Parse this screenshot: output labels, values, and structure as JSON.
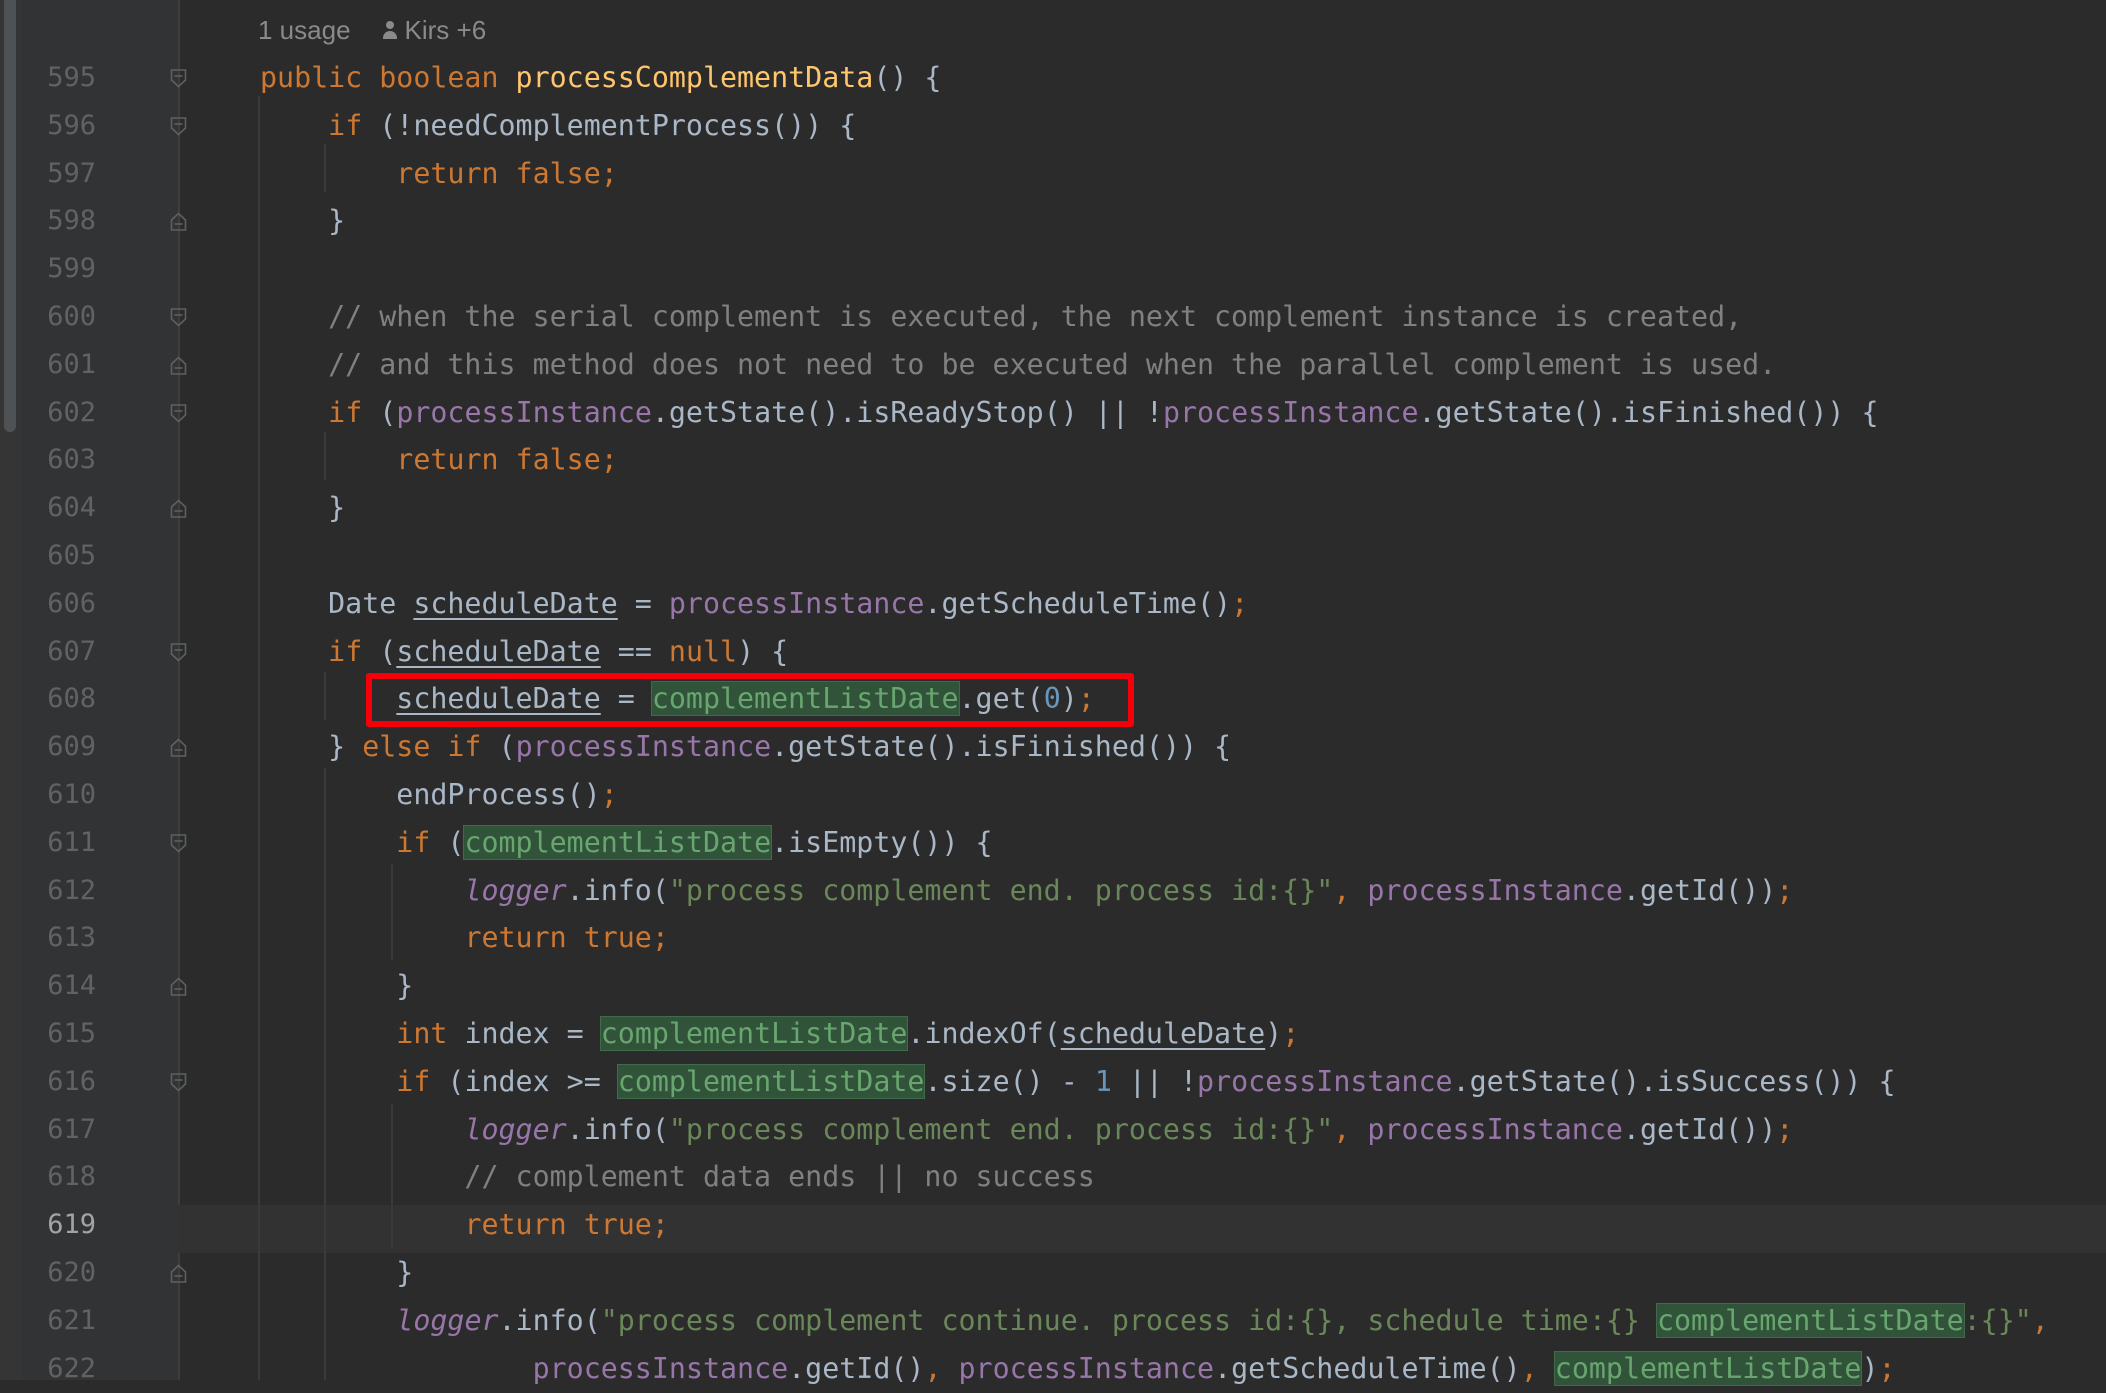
{
  "inlay": {
    "usages": "1 usage",
    "authors": "Kirs +6"
  },
  "colors": {
    "background": "#2b2b2b",
    "keyword": "#cc7832",
    "method": "#ffc66d",
    "field": "#9876aa",
    "comment": "#808080",
    "string": "#6a8759",
    "number": "#6897bb",
    "annotation_box": "#f5000a"
  },
  "lines": [
    {
      "n": "595",
      "tokens": [
        [
          "public boolean ",
          "kw"
        ],
        [
          "processComplementData",
          "fn"
        ],
        [
          "() {",
          ""
        ]
      ]
    },
    {
      "n": "596",
      "tokens": [
        [
          "    ",
          ""
        ],
        [
          "if ",
          "kw"
        ],
        [
          "(!needComplementProcess()) {",
          ""
        ]
      ]
    },
    {
      "n": "597",
      "tokens": [
        [
          "        ",
          ""
        ],
        [
          "return false;",
          "kw"
        ]
      ]
    },
    {
      "n": "598",
      "tokens": [
        [
          "    }",
          ""
        ]
      ]
    },
    {
      "n": "599",
      "tokens": []
    },
    {
      "n": "600",
      "tokens": [
        [
          "    // when the serial complement is executed, the next complement instance is created,",
          "cmt"
        ]
      ]
    },
    {
      "n": "601",
      "tokens": [
        [
          "    // and this method does not need to be executed when the parallel complement is used.",
          "cmt"
        ]
      ]
    },
    {
      "n": "602",
      "tokens": [
        [
          "    ",
          ""
        ],
        [
          "if ",
          "kw"
        ],
        [
          "(",
          ""
        ],
        [
          "processInstance",
          "fld"
        ],
        [
          ".getState().isReadyStop() || !",
          ""
        ],
        [
          "processInstance",
          "fld"
        ],
        [
          ".getState().isFinished()) {",
          ""
        ]
      ]
    },
    {
      "n": "603",
      "tokens": [
        [
          "        ",
          ""
        ],
        [
          "return false;",
          "kw"
        ]
      ]
    },
    {
      "n": "604",
      "tokens": [
        [
          "    }",
          ""
        ]
      ]
    },
    {
      "n": "605",
      "tokens": []
    },
    {
      "n": "606",
      "tokens": [
        [
          "    Date ",
          ""
        ],
        [
          "scheduleDate",
          "var"
        ],
        [
          " = ",
          ""
        ],
        [
          "processInstance",
          "fld"
        ],
        [
          ".getScheduleTime()",
          ""
        ],
        [
          ";",
          "kw"
        ]
      ]
    },
    {
      "n": "607",
      "tokens": [
        [
          "    ",
          ""
        ],
        [
          "if ",
          "kw"
        ],
        [
          "(",
          ""
        ],
        [
          "scheduleDate",
          "var"
        ],
        [
          " == ",
          ""
        ],
        [
          "null",
          "kw"
        ],
        [
          ") {",
          ""
        ]
      ]
    },
    {
      "n": "608",
      "tokens": [
        [
          "        ",
          ""
        ],
        [
          "scheduleDate",
          "var"
        ],
        [
          " = ",
          ""
        ],
        [
          "complementListDate",
          "hl"
        ],
        [
          ".get(",
          ""
        ],
        [
          "0",
          "num"
        ],
        [
          ")",
          ""
        ],
        [
          ";",
          "kw"
        ]
      ]
    },
    {
      "n": "609",
      "tokens": [
        [
          "    } ",
          ""
        ],
        [
          "else if ",
          "kw"
        ],
        [
          "(",
          ""
        ],
        [
          "processInstance",
          "fld"
        ],
        [
          ".getState().isFinished()) {",
          ""
        ]
      ]
    },
    {
      "n": "610",
      "tokens": [
        [
          "        endProcess()",
          ""
        ],
        [
          ";",
          "kw"
        ]
      ]
    },
    {
      "n": "611",
      "tokens": [
        [
          "        ",
          ""
        ],
        [
          "if ",
          "kw"
        ],
        [
          "(",
          ""
        ],
        [
          "complementListDate",
          "hl"
        ],
        [
          ".isEmpty()) {",
          ""
        ]
      ]
    },
    {
      "n": "612",
      "tokens": [
        [
          "            ",
          ""
        ],
        [
          "logger",
          "fld ital"
        ],
        [
          ".info(",
          ""
        ],
        [
          "\"process complement end. process id:{}\"",
          "str"
        ],
        [
          ", ",
          "kw"
        ],
        [
          "processInstance",
          "fld"
        ],
        [
          ".getId())",
          ""
        ],
        [
          ";",
          "kw"
        ]
      ]
    },
    {
      "n": "613",
      "tokens": [
        [
          "            ",
          ""
        ],
        [
          "return true;",
          "kw"
        ]
      ]
    },
    {
      "n": "614",
      "tokens": [
        [
          "        }",
          ""
        ]
      ]
    },
    {
      "n": "615",
      "tokens": [
        [
          "        ",
          ""
        ],
        [
          "int ",
          "kw"
        ],
        [
          "index = ",
          ""
        ],
        [
          "complementListDate",
          "hl"
        ],
        [
          ".indexOf(",
          ""
        ],
        [
          "scheduleDate",
          "var"
        ],
        [
          ")",
          ""
        ],
        [
          ";",
          "kw"
        ]
      ]
    },
    {
      "n": "616",
      "tokens": [
        [
          "        ",
          ""
        ],
        [
          "if ",
          "kw"
        ],
        [
          "(index >= ",
          ""
        ],
        [
          "complementListDate",
          "hl"
        ],
        [
          ".size() - ",
          ""
        ],
        [
          "1",
          "num"
        ],
        [
          " || !",
          ""
        ],
        [
          "processInstance",
          "fld"
        ],
        [
          ".getState().isSuccess()) {",
          ""
        ]
      ]
    },
    {
      "n": "617",
      "tokens": [
        [
          "            ",
          ""
        ],
        [
          "logger",
          "fld ital"
        ],
        [
          ".info(",
          ""
        ],
        [
          "\"process complement end. process id:{}\"",
          "str"
        ],
        [
          ", ",
          "kw"
        ],
        [
          "processInstance",
          "fld"
        ],
        [
          ".getId())",
          ""
        ],
        [
          ";",
          "kw"
        ]
      ]
    },
    {
      "n": "618",
      "tokens": [
        [
          "            // complement data ends || no success",
          "cmt"
        ]
      ]
    },
    {
      "n": "619",
      "tokens": [
        [
          "            ",
          ""
        ],
        [
          "return true;",
          "kw"
        ]
      ]
    },
    {
      "n": "620",
      "tokens": [
        [
          "        }",
          ""
        ]
      ]
    },
    {
      "n": "621",
      "tokens": [
        [
          "        ",
          ""
        ],
        [
          "logger",
          "fld ital"
        ],
        [
          ".info(",
          ""
        ],
        [
          "\"process complement continue. process id:{}, schedule time:{} ",
          "str"
        ],
        [
          "complementListDate",
          "hl"
        ],
        [
          ":{}\"",
          "str"
        ],
        [
          ",",
          "kw"
        ]
      ]
    },
    {
      "n": "622",
      "tokens": [
        [
          "                ",
          ""
        ],
        [
          "processInstance",
          "fld"
        ],
        [
          ".getId()",
          ""
        ],
        [
          ", ",
          "kw"
        ],
        [
          "processInstance",
          "fld"
        ],
        [
          ".getScheduleTime()",
          ""
        ],
        [
          ", ",
          "kw"
        ],
        [
          "complementListDate",
          "hl"
        ],
        [
          ")",
          ""
        ],
        [
          ";",
          "kw"
        ]
      ]
    }
  ]
}
